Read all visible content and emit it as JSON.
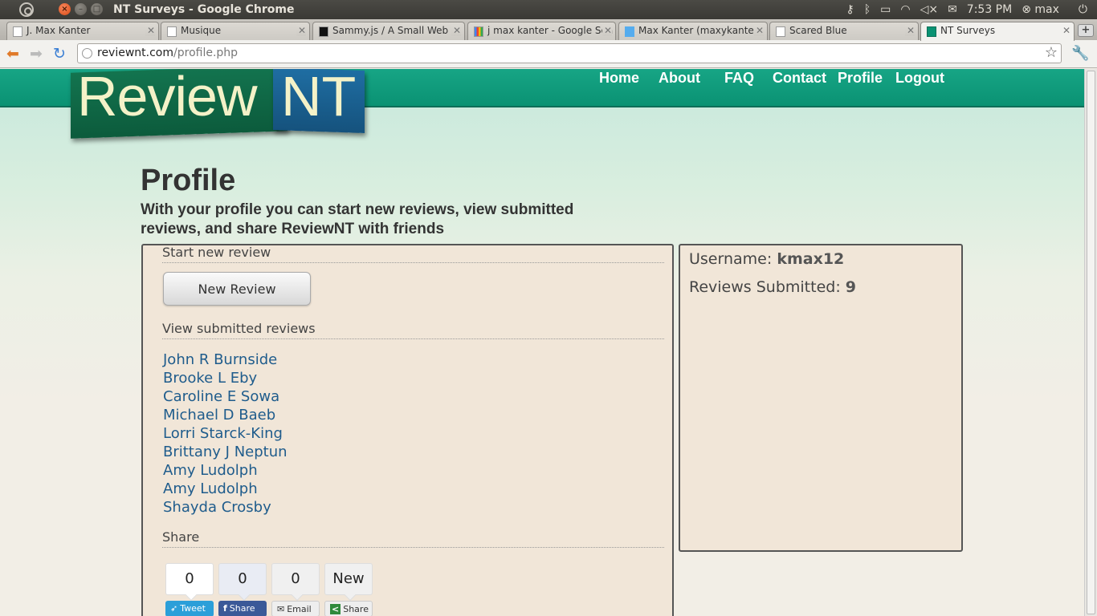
{
  "os": {
    "window_title": "NT Surveys - Google Chrome",
    "clock": "7:53 PM",
    "user": "max"
  },
  "browser": {
    "tabs": [
      {
        "label": "J. Max Kanter"
      },
      {
        "label": "Musique"
      },
      {
        "label": "Sammy.js / A Small Web Fr"
      },
      {
        "label": "j max kanter - Google Sea"
      },
      {
        "label": "Max Kanter (maxykanter)"
      },
      {
        "label": "Scared Blue"
      },
      {
        "label": "NT Surveys"
      }
    ],
    "url_host": "reviewnt.com",
    "url_path": "/profile.php"
  },
  "site": {
    "logo_left": "Review",
    "logo_right": "NT",
    "nav": [
      "Home",
      "About",
      "FAQ",
      "Contact",
      "Profile",
      "Logout"
    ]
  },
  "page": {
    "title": "Profile",
    "subtitle": "With your profile you can start new reviews, view submitted reviews, and share ReviewNT with friends"
  },
  "left_panel": {
    "start_heading": "Start new review",
    "new_review_button": "New Review",
    "view_heading": "View submitted reviews",
    "reviews": [
      "John R Burnside",
      "Brooke L Eby",
      "Caroline E Sowa",
      "Michael D Baeb",
      "Lorri Starck-King",
      "Brittany J Neptun",
      "Amy Ludolph",
      "Amy Ludolph",
      "Shayda Crosby"
    ],
    "share_heading": "Share",
    "share": [
      {
        "count": "0",
        "label": "Tweet",
        "icon": "twitter-bird-icon",
        "color": "#2b9fd9"
      },
      {
        "count": "0",
        "label": "Share",
        "icon": "facebook-f-icon",
        "color": "#3b5998"
      },
      {
        "count": "0",
        "label": "Email",
        "icon": "envelope-icon",
        "color": "#eeeeee"
      },
      {
        "count": "New",
        "label": "Share",
        "icon": "share-icon",
        "color": "#eeeeee"
      }
    ]
  },
  "right_panel": {
    "username_label": "Username:",
    "username": "kmax12",
    "reviews_label": "Reviews Submitted:",
    "reviews_count": "9"
  },
  "colors": {
    "header_green": "#0a9273",
    "link_blue": "#1f5c8c",
    "panel_bg": "#f1e6d8"
  }
}
